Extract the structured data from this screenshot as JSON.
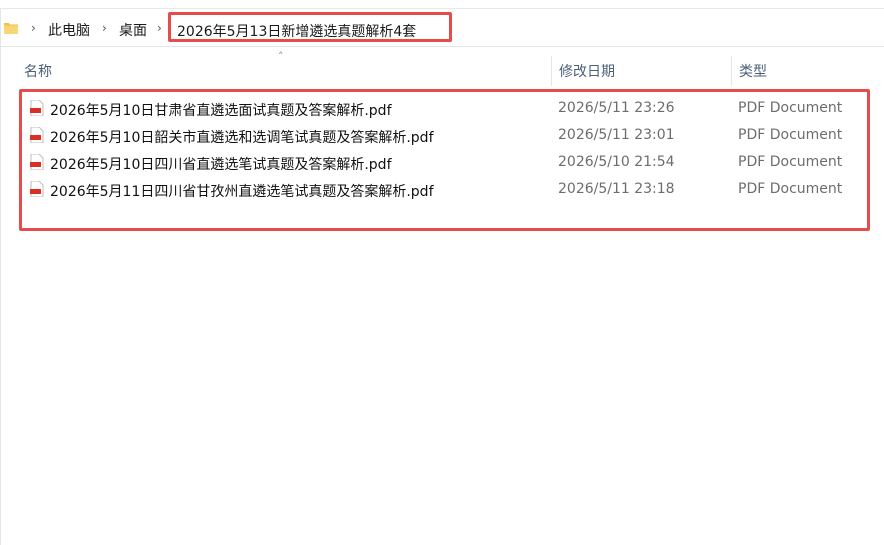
{
  "breadcrumb": {
    "items": [
      "此电脑",
      "桌面"
    ],
    "current": "2026年5月13日新增遴选真题解析4套"
  },
  "columns": {
    "name": "名称",
    "date": "修改日期",
    "type": "类型"
  },
  "files": [
    {
      "name": "2026年5月10日甘肃省直遴选面试真题及答案解析.pdf",
      "date": "2026/5/11 23:26",
      "type": "PDF Document"
    },
    {
      "name": "2026年5月10日韶关市直遴选和选调笔试真题及答案解析.pdf",
      "date": "2026/5/11 23:01",
      "type": "PDF Document"
    },
    {
      "name": "2026年5月10日四川省直遴选笔试真题及答案解析.pdf",
      "date": "2026/5/10 21:54",
      "type": "PDF Document"
    },
    {
      "name": "2026年5月11日四川省甘孜州直遴选笔试真题及答案解析.pdf",
      "date": "2026/5/11 23:18",
      "type": "PDF Document"
    }
  ],
  "colors": {
    "highlight": "#e74c4c",
    "folder": "#f3c244",
    "pdf": "#d93025",
    "header_text": "#4c607a"
  }
}
